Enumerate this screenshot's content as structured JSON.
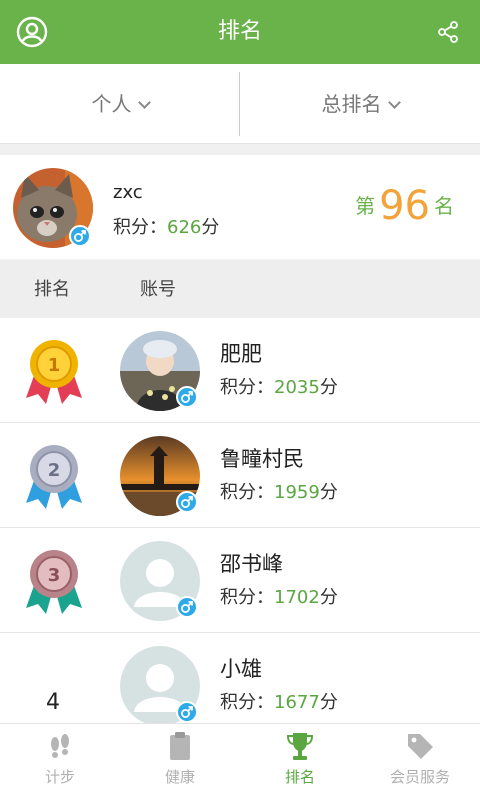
{
  "header": {
    "title": "排名",
    "profile_icon": "user-circle-icon",
    "share_icon": "share-icon"
  },
  "filters": {
    "scope": "个人",
    "range": "总排名"
  },
  "me": {
    "name": "zxc",
    "score_label": "积分：",
    "score": "626",
    "score_unit": "分",
    "rank_prefix": "第",
    "rank": "96",
    "rank_suffix": "名",
    "gender": "♂"
  },
  "columns": {
    "rank": "排名",
    "account": "账号"
  },
  "rows": [
    {
      "rank": "1",
      "name": "肥肥",
      "score": "2035",
      "score_label": "积分：",
      "score_unit": "分",
      "gender": "♂"
    },
    {
      "rank": "2",
      "name": "鲁疃村民",
      "score": "1959",
      "score_label": "积分：",
      "score_unit": "分",
      "gender": "♂"
    },
    {
      "rank": "3",
      "name": "邵书峰",
      "score": "1702",
      "score_label": "积分：",
      "score_unit": "分",
      "gender": "♂"
    },
    {
      "rank": "4",
      "name": "小雄",
      "score": "1677",
      "score_label": "积分：",
      "score_unit": "分",
      "gender": "♂"
    }
  ],
  "tabs": [
    {
      "label": "计步",
      "icon": "footprints-icon"
    },
    {
      "label": "健康",
      "icon": "clipboard-icon"
    },
    {
      "label": "排名",
      "icon": "trophy-icon"
    },
    {
      "label": "会员服务",
      "icon": "tag-icon"
    }
  ],
  "colors": {
    "brand_green": "#6ab34a",
    "rank_orange": "#f2a33a",
    "gender_blue": "#2eaae8",
    "gold": "#f0b400",
    "silver": "#a9adc0",
    "bronze": "#b9838a"
  }
}
